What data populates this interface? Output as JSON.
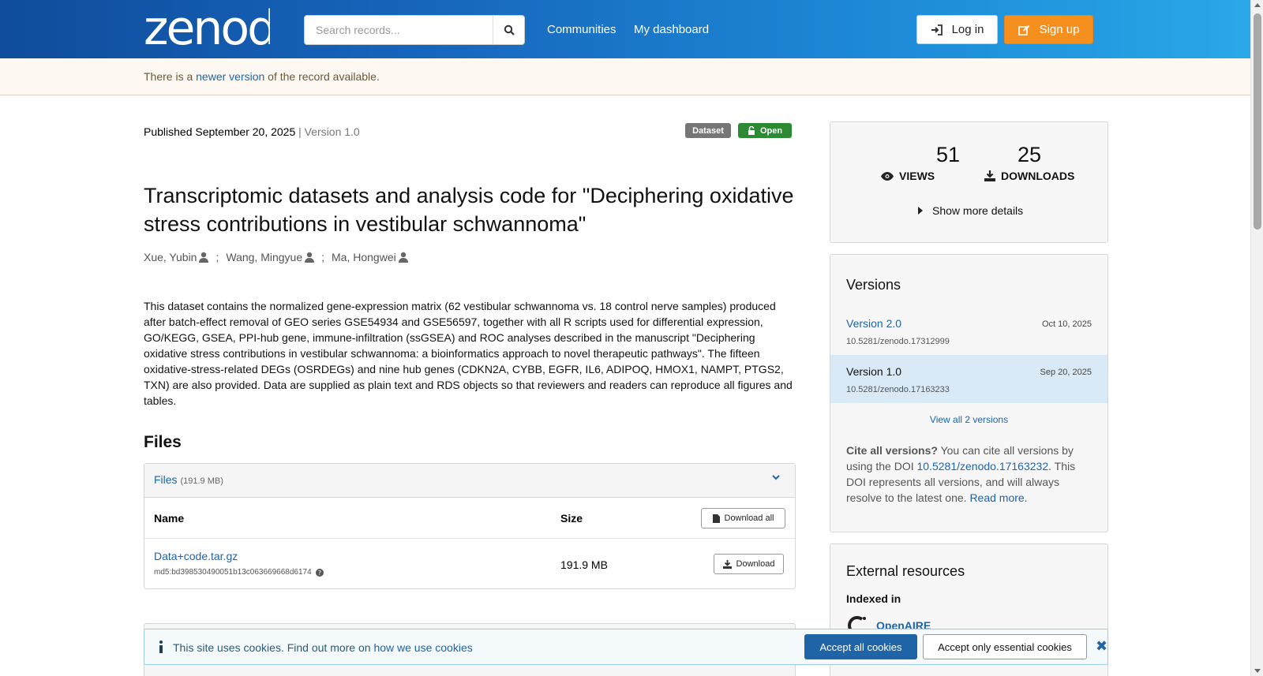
{
  "header": {
    "logo_text": "zenodo",
    "search_placeholder": "Search records...",
    "nav": [
      "Communities",
      "My dashboard"
    ],
    "login_label": "Log in",
    "signup_label": "Sign up"
  },
  "notice": {
    "prefix": "There is a ",
    "link": "newer version",
    "suffix": " of the record available."
  },
  "record": {
    "published": "Published September 20, 2025",
    "version_sep": " | ",
    "version": "Version 1.0",
    "badge_type": "Dataset",
    "badge_access": "Open",
    "title": "Transcriptomic datasets and analysis code for \"Deciphering oxidative stress contributions in vestibular schwannoma\"",
    "authors": [
      "Xue, Yubin",
      "Wang, Mingyue",
      "Ma, Hongwei"
    ],
    "author_sep": ";",
    "description": "This dataset contains the normalized gene-expression matrix (62 vestibular schwannoma vs. 18 control nerve samples) produced after batch-effect removal of GEO series GSE54934 and GSE56597, together with all R scripts used for differential expression, GO/KEGG, GSEA, PPI-hub gene, immune-infiltration (ssGSEA) and ROC analyses described in the manuscript \"Deciphering oxidative stress contributions in vestibular schwannoma: a bioinformatics approach to novel therapeutic pathways\". The fifteen oxidative-stress-related DEGs (OSRDEGs) and nine hub genes (CDKN2A, CYBB, EGFR, IL6, ADIPOQ, HMOX1, NAMPT, PTGS2, TXN) are also provided. Data are supplied as plain text and RDS objects so that reviewers and readers can reproduce all figures and tables."
  },
  "files": {
    "heading": "Files",
    "panel_label": "Files",
    "panel_size": "(191.9 MB)",
    "col_name": "Name",
    "col_size": "Size",
    "download_all": "Download all",
    "rows": [
      {
        "name": "Data+code.tar.gz",
        "md5": "md5:bd398530490051b13c063669668d6174",
        "size": "191.9 MB",
        "download": "Download"
      }
    ]
  },
  "stats": {
    "views": "51",
    "views_label": "VIEWS",
    "downloads": "25",
    "downloads_label": "DOWNLOADS",
    "show_more": "Show more details"
  },
  "versions": {
    "title": "Versions",
    "items": [
      {
        "name": "Version 2.0",
        "doi": "10.5281/zenodo.17312999",
        "date": "Oct 10, 2025",
        "active": false
      },
      {
        "name": "Version 1.0",
        "doi": "10.5281/zenodo.17163233",
        "date": "Sep 20, 2025",
        "active": true
      }
    ],
    "view_all": "View all 2 versions",
    "cite_bold": "Cite all versions?",
    "cite_text1": " You can cite all versions by using the DOI ",
    "cite_doi": "10.5281/zenodo.17163232",
    "cite_text2": ". This DOI represents all versions, and will always resolve to the latest one. ",
    "read_more": "Read more",
    "read_more_suffix": "."
  },
  "external": {
    "title": "External resources",
    "indexed_in": "Indexed in",
    "resource": "OpenAIRE"
  },
  "cookie": {
    "text": "This site uses cookies. Find out more on ",
    "link": "how we use cookies",
    "accept_all": "Accept all cookies",
    "accept_essential": "Accept only essential cookies",
    "close": "✖"
  },
  "colors": {
    "brand_blue": "#1767be",
    "signup_orange": "#f5901e",
    "open_green": "#2c8a35",
    "link_blue": "#1c64ae"
  }
}
